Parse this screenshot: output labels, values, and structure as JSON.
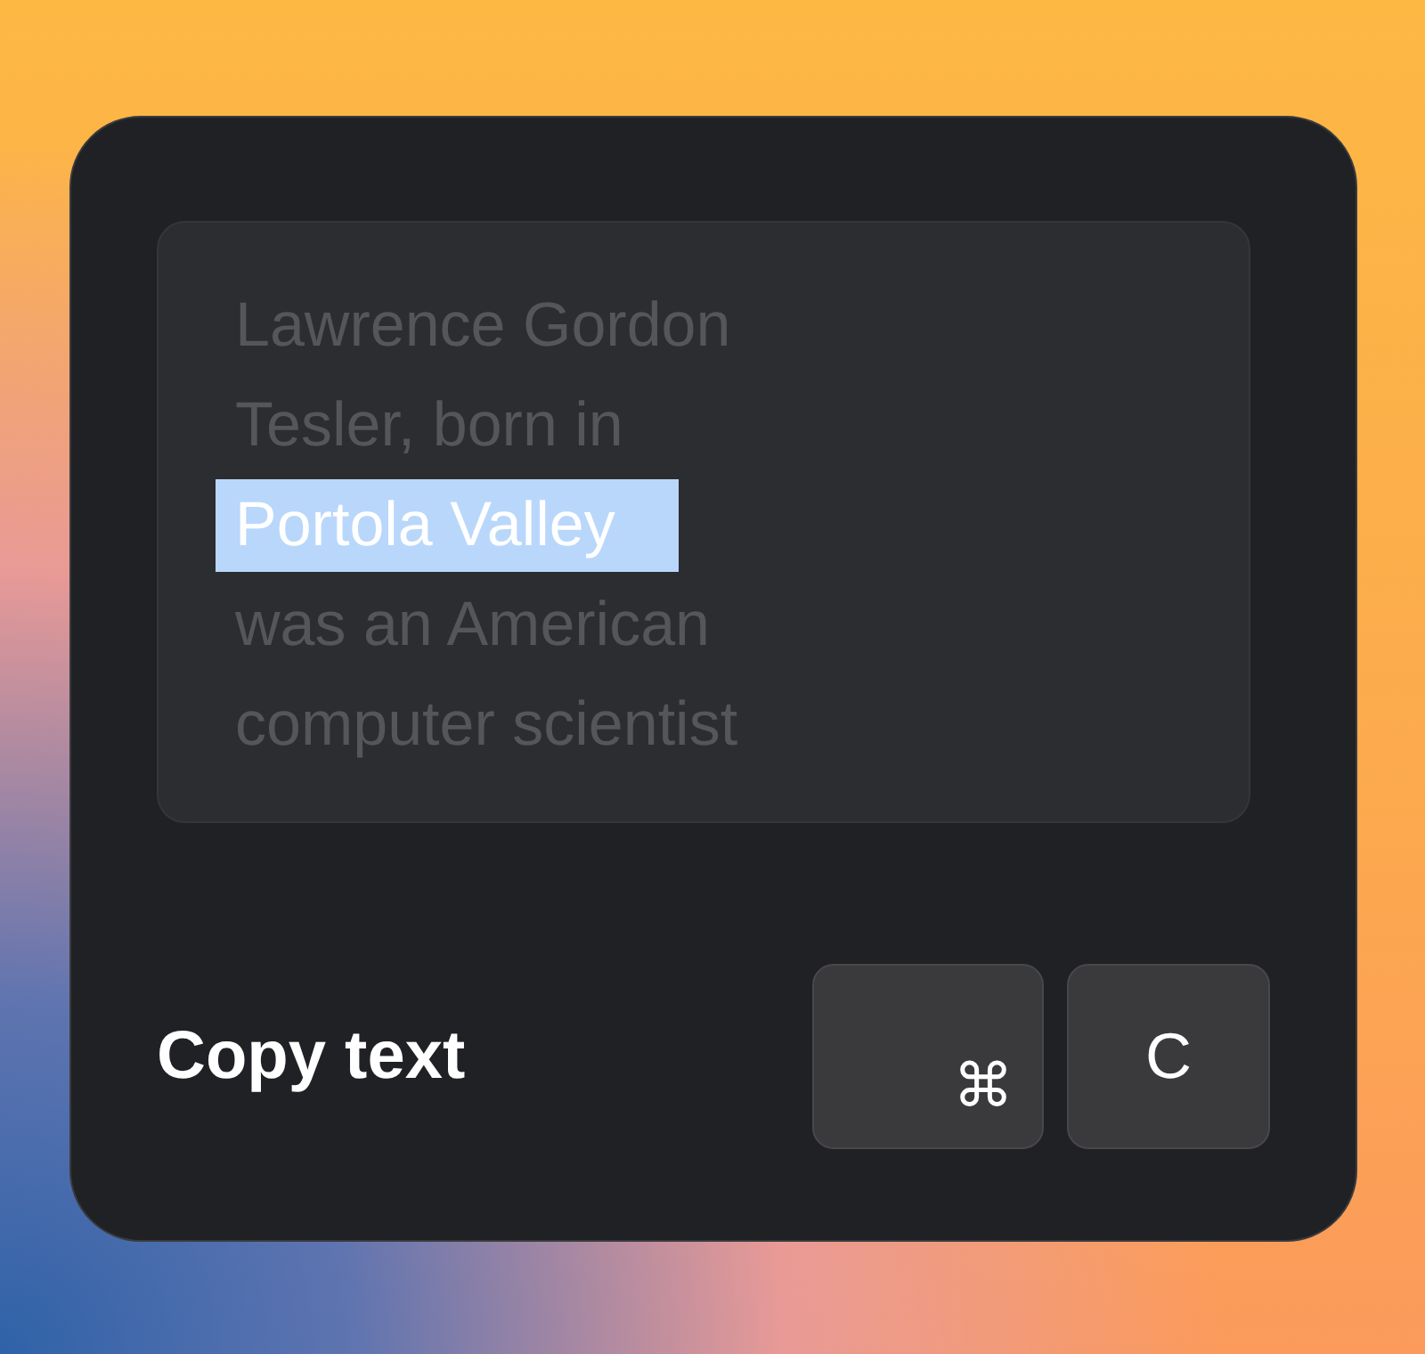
{
  "text_lines": [
    {
      "text": "Lawrence Gordon",
      "selected": false
    },
    {
      "text": "Tesler, born in",
      "selected": false
    },
    {
      "text": "Portola Valley",
      "selected": true
    },
    {
      "text": "was an American",
      "selected": false
    },
    {
      "text": "computer scientist",
      "selected": false
    }
  ],
  "action_label": "Copy text",
  "keys": [
    {
      "label": "⌘",
      "kind": "modifier"
    },
    {
      "label": "C",
      "kind": "letter"
    }
  ]
}
